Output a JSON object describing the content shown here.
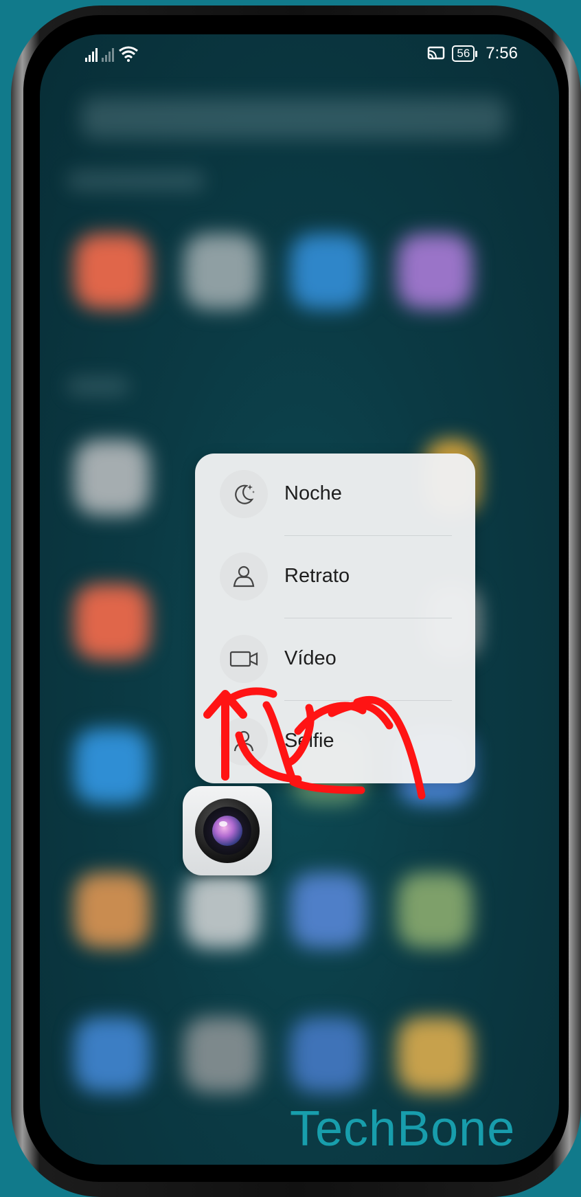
{
  "status_bar": {
    "time": "7:56",
    "battery": "56",
    "signal_icon": "signal-bars-icon",
    "wifi_icon": "wifi-icon",
    "cast_icon": "cast-icon"
  },
  "shortcut_menu": {
    "items": [
      {
        "label": "Noche",
        "icon": "moon-stars-icon"
      },
      {
        "label": "Retrato",
        "icon": "person-portrait-icon"
      },
      {
        "label": "Vídeo",
        "icon": "video-camera-icon"
      },
      {
        "label": "Selfie",
        "icon": "person-icon"
      }
    ]
  },
  "app": {
    "name_icon": "camera-app-icon"
  },
  "annotation": {
    "arrow": "swipe-up-arrow-icon",
    "hand": "hand-gesture-icon",
    "color": "#ff1414"
  },
  "watermark": "TechBone"
}
